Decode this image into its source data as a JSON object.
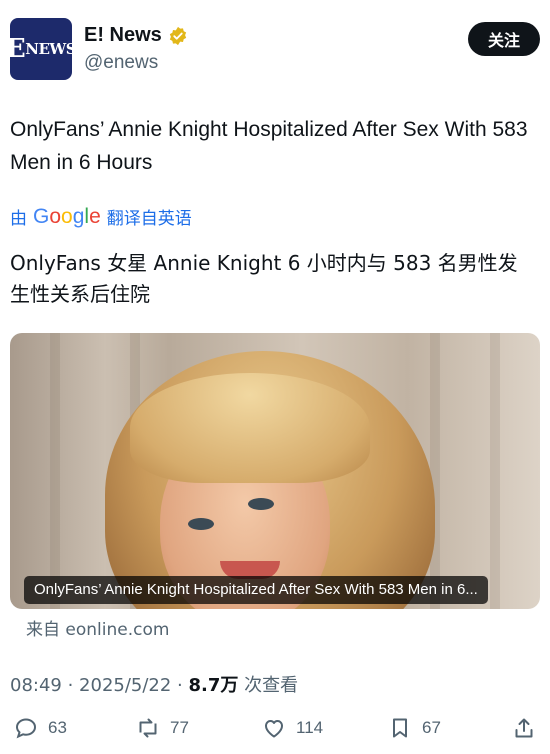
{
  "account": {
    "avatar_text": "E",
    "avatar_text_small": "NEWS",
    "name": "E! News",
    "handle": "@enews",
    "follow_label": "关注"
  },
  "tweet": {
    "text": "OnlyFans’ Annie Knight Hospitalized After Sex With 583 Men in 6 Hours",
    "translate_prefix": "由",
    "translate_google": [
      "G",
      "o",
      "o",
      "g",
      "l",
      "e"
    ],
    "translate_suffix": "翻译自英语",
    "translated_text": "OnlyFans 女星 Annie Knight 6 小时内与 583 名男性发生性关系后住院"
  },
  "card": {
    "caption": "OnlyFans’ Annie Knight Hospitalized After Sex With 583 Men in 6...",
    "source": "来自 eonline.com"
  },
  "meta": {
    "time": "08:49 · 2025/5/22 · ",
    "views": "8.7万",
    "views_suffix": " 次查看"
  },
  "actions": {
    "replies": "63",
    "retweets": "77",
    "likes": "114",
    "bookmarks": "67"
  },
  "colors": {
    "accent_link": "#1d6ee8",
    "verified_gold": "#e2b719",
    "muted": "#536471"
  }
}
